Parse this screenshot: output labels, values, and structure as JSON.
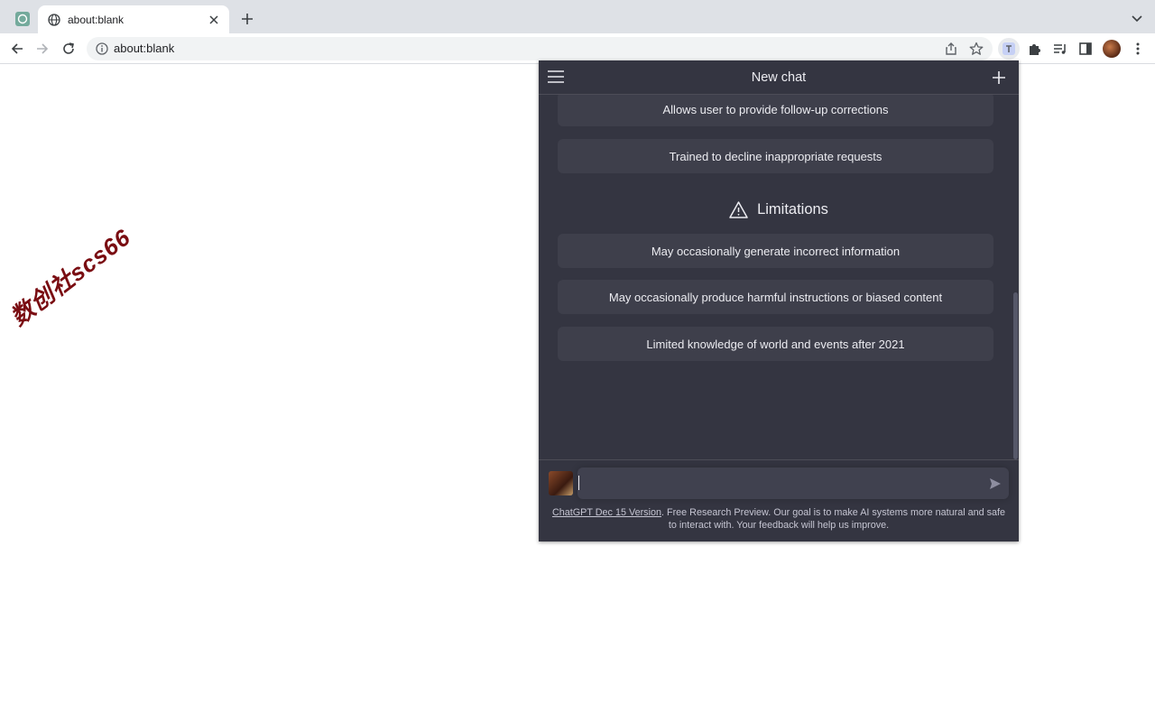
{
  "browser": {
    "tab_title": "about:blank",
    "url": "about:blank"
  },
  "watermark": "数创社scs66",
  "popup": {
    "header_title": "New chat",
    "capabilities_items": [
      "Allows user to provide follow-up corrections",
      "Trained to decline inappropriate requests"
    ],
    "limitations_title": "Limitations",
    "limitations_items": [
      "May occasionally generate incorrect information",
      "May occasionally produce harmful instructions or biased content",
      "Limited knowledge of world and events after 2021"
    ],
    "input_value": "",
    "footer_link": "ChatGPT Dec 15 Version",
    "footer_text": ". Free Research Preview. Our goal is to make AI systems more natural and safe to interact with. Your feedback will help us improve."
  },
  "colors": {
    "popup_bg": "#343541",
    "card_bg": "#3e3f4b",
    "text": "#ececf1",
    "tabstrip_bg": "#dee1e6"
  },
  "icons": [
    "chatgpt-tab-icon",
    "globe-icon",
    "close-icon",
    "plus-icon",
    "chevron-down-icon",
    "back-arrow-icon",
    "forward-arrow-icon",
    "reload-icon",
    "info-icon",
    "share-icon",
    "star-icon",
    "extension-icon",
    "puzzle-icon",
    "media-control-icon",
    "side-panel-icon",
    "avatar",
    "kebab-menu-icon",
    "hamburger-menu-icon",
    "new-chat-plus-icon",
    "warning-triangle-icon",
    "send-icon"
  ]
}
